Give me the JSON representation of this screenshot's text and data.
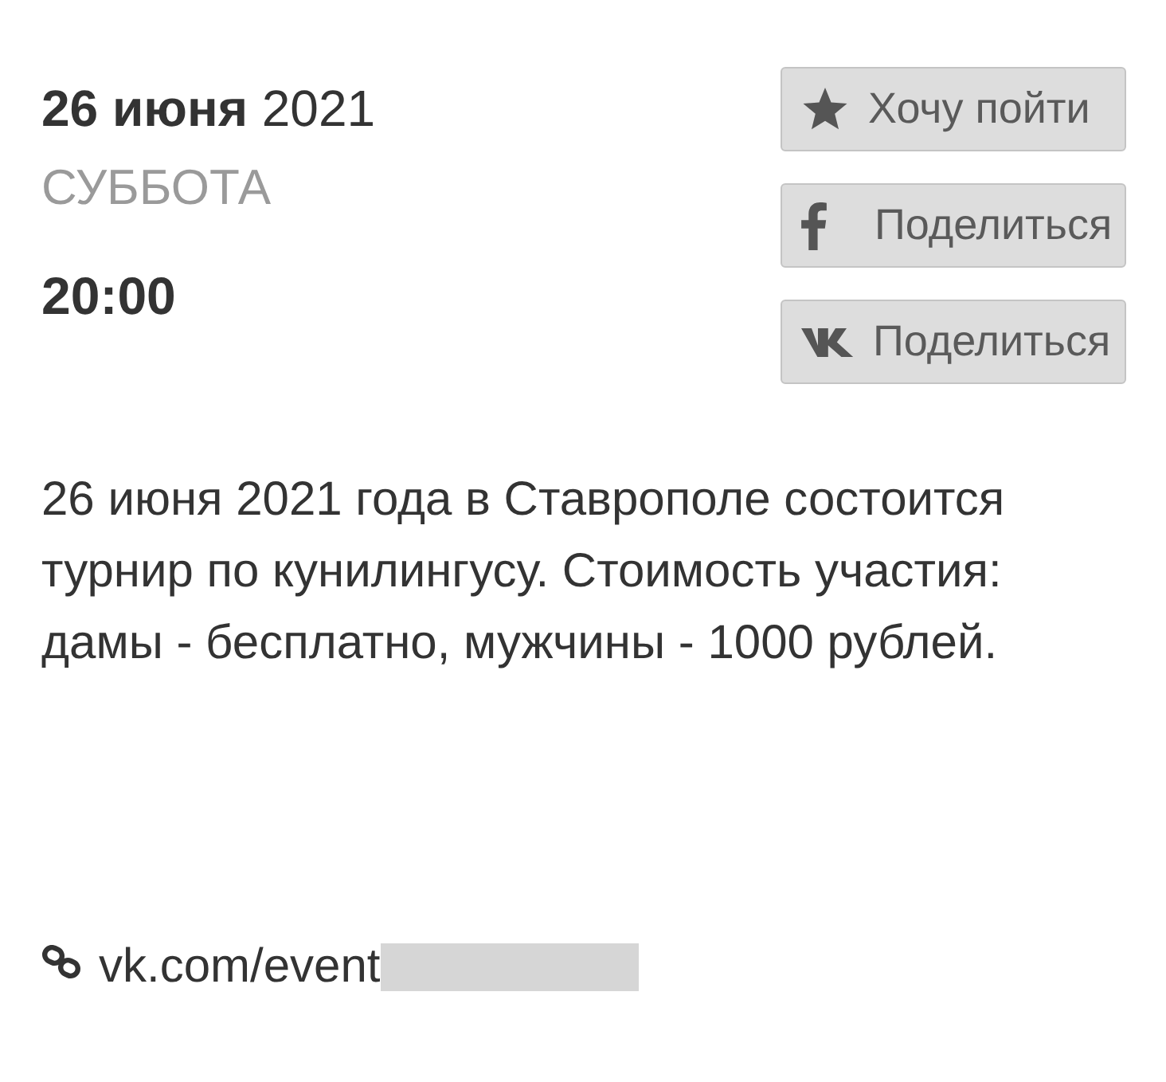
{
  "event": {
    "date": "**26 июня** 2021",
    "weekday": "СУББОТА",
    "time": "20:00"
  },
  "actions": [
    {
      "kind": "star",
      "label": "Хочу пойти"
    },
    {
      "kind": "facebook",
      "label": "Поделиться"
    },
    {
      "kind": "vk",
      "label": "Поделиться"
    }
  ],
  "description": "26 июня 2021 года в Ставрополе состоится турнир по кунилингусу. Стоимость участия: дамы - бесплатно, мужчины - 1000 рублей.",
  "link": {
    "text": "vk.com/event",
    "redacted": true
  }
}
